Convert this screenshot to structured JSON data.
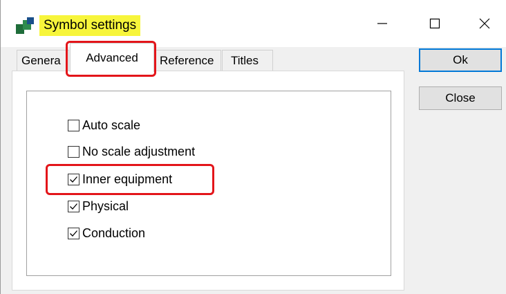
{
  "window": {
    "title": "Symbol settings",
    "minimize_glyph": "—",
    "maximize_glyph": "☐",
    "close_glyph": "✕",
    "title_highlight_color": "#f7f53b",
    "annotation_color": "#e3151a"
  },
  "tabs": [
    {
      "label": "General",
      "visible_label": "Genera",
      "selected": false
    },
    {
      "label": "Advanced",
      "selected": true
    },
    {
      "label": "Reference",
      "selected": false
    },
    {
      "label": "Titles",
      "selected": false
    }
  ],
  "options": [
    {
      "label": "Auto scale",
      "checked": false
    },
    {
      "label": "No scale adjustment",
      "checked": false
    },
    {
      "label": "Inner equipment",
      "checked": true
    },
    {
      "label": "Physical",
      "checked": true
    },
    {
      "label": "Conduction",
      "checked": true
    }
  ],
  "buttons": {
    "ok_label": "Ok",
    "close_label": "Close"
  },
  "icons": {
    "app": "symbol-settings-app-icon",
    "check": "checkmark-icon"
  }
}
